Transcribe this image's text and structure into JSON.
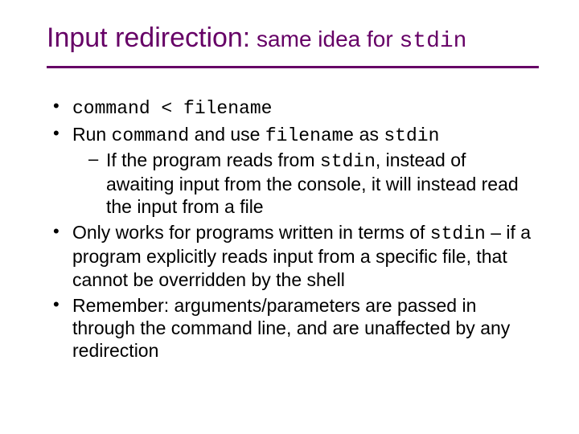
{
  "title": {
    "main": "Input redirection:",
    "tail_plain": " same idea for ",
    "tail_code": "stdin"
  },
  "bullets": {
    "b1": {
      "code": "command < filename"
    },
    "b2": {
      "pre": "Run ",
      "code1": "command",
      "mid": " and use ",
      "code2": "filename",
      "mid2": " as ",
      "code3": "stdin",
      "sub": {
        "pre": "If the program reads from ",
        "code": "stdin",
        "post": ", instead of awaiting input from the console, it will instead read the input from a file"
      }
    },
    "b3": {
      "pre": "Only works for programs written in terms of ",
      "code": "stdin",
      "post": " – if a program explicitly reads input from a specific file, that cannot be overridden by the shell"
    },
    "b4": {
      "text": "Remember: arguments/parameters are passed in through the command line, and are unaffected by any redirection"
    }
  }
}
